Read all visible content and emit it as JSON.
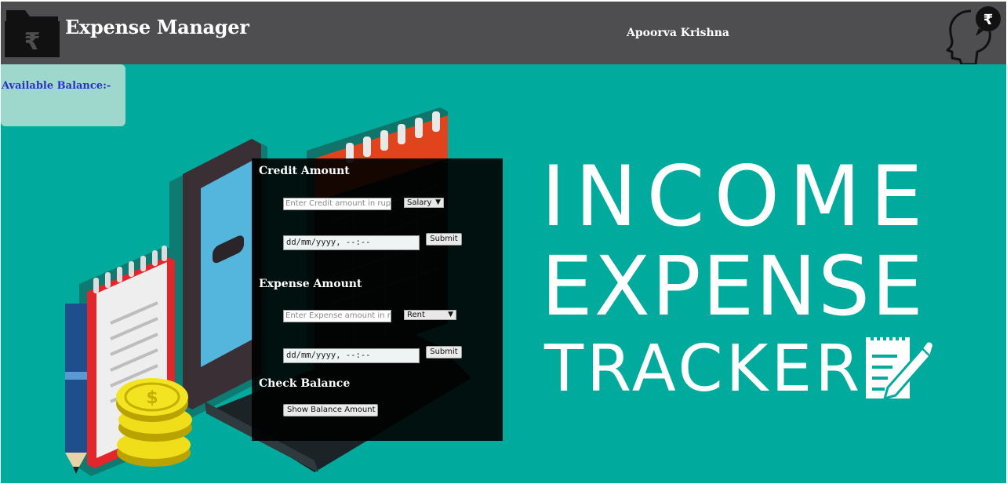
{
  "header": {
    "app_title": "Expense Manager",
    "user_name": "Apoorva Krishna",
    "logo_icon": "rupee-folder-icon",
    "profile_icon": "rupee-thought-head-icon",
    "logo_symbol": "₹"
  },
  "balance": {
    "label": "Available Balance:-"
  },
  "credit": {
    "title": "Credit Amount",
    "amount_placeholder": "Enter Credit amount in rupees",
    "category_selected": "Salary",
    "date_value": "dd/mm/yyyy, --:--",
    "submit_label": "Submit"
  },
  "expense": {
    "title": "Expense Amount",
    "amount_placeholder": "Enter  Expense amount in rupees",
    "category_selected": "Rent",
    "date_value": "dd/mm/yyyy, --:--",
    "submit_label": "Submit"
  },
  "check": {
    "title": "Check Balance",
    "button_label": "Show Balance Amount"
  },
  "banner": {
    "line1": "INCOME",
    "line2": "EXPENSE",
    "line3": "TRACKER",
    "icon": "notepad-pencil-icon"
  },
  "colors": {
    "header_bg": "#4e4e50",
    "hero_bg": "#00ab9d",
    "balance_text": "#2b31c6"
  }
}
